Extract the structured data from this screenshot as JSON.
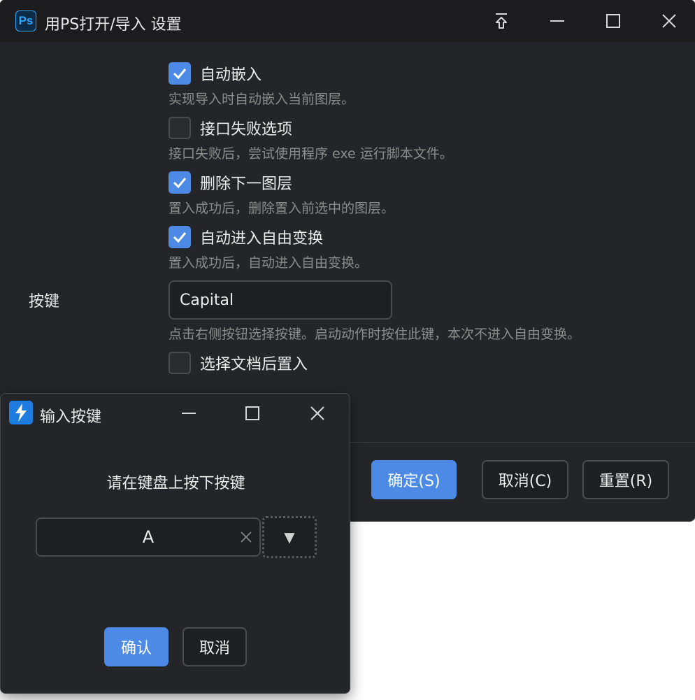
{
  "main": {
    "app_icon_text": "Ps",
    "title": "用PS打开/导入 设置",
    "options": [
      {
        "label": "自动嵌入",
        "desc": "实现导入时自动嵌入当前图层。",
        "checked": true
      },
      {
        "label": "接口失败选项",
        "desc": "接口失败后，尝试使用程序 exe 运行脚本文件。",
        "checked": false
      },
      {
        "label": "删除下一图层",
        "desc": "置入成功后，删除置入前选中的图层。",
        "checked": true
      },
      {
        "label": "自动进入自由变换",
        "desc": "置入成功后，自动进入自由变换。",
        "checked": true
      }
    ],
    "key_label": "按键",
    "key_value": "Capital",
    "key_desc": "点击右侧按钮选择按键。启动动作时按住此键，本次不进入自由变换。",
    "after_option": {
      "label": "选择文档后置入",
      "checked": false
    },
    "buttons": {
      "ok": "确定(S)",
      "cancel": "取消(C)",
      "reset": "重置(R)"
    }
  },
  "dialog": {
    "title": "输入按键",
    "message": "请在键盘上按下按键",
    "key_value": "A",
    "dropdown_glyph": "▼",
    "buttons": {
      "confirm": "确认",
      "cancel": "取消"
    }
  },
  "colors": {
    "accent": "#4c8ae6",
    "background": "#242528",
    "titlebar": "#1c1c1e"
  }
}
